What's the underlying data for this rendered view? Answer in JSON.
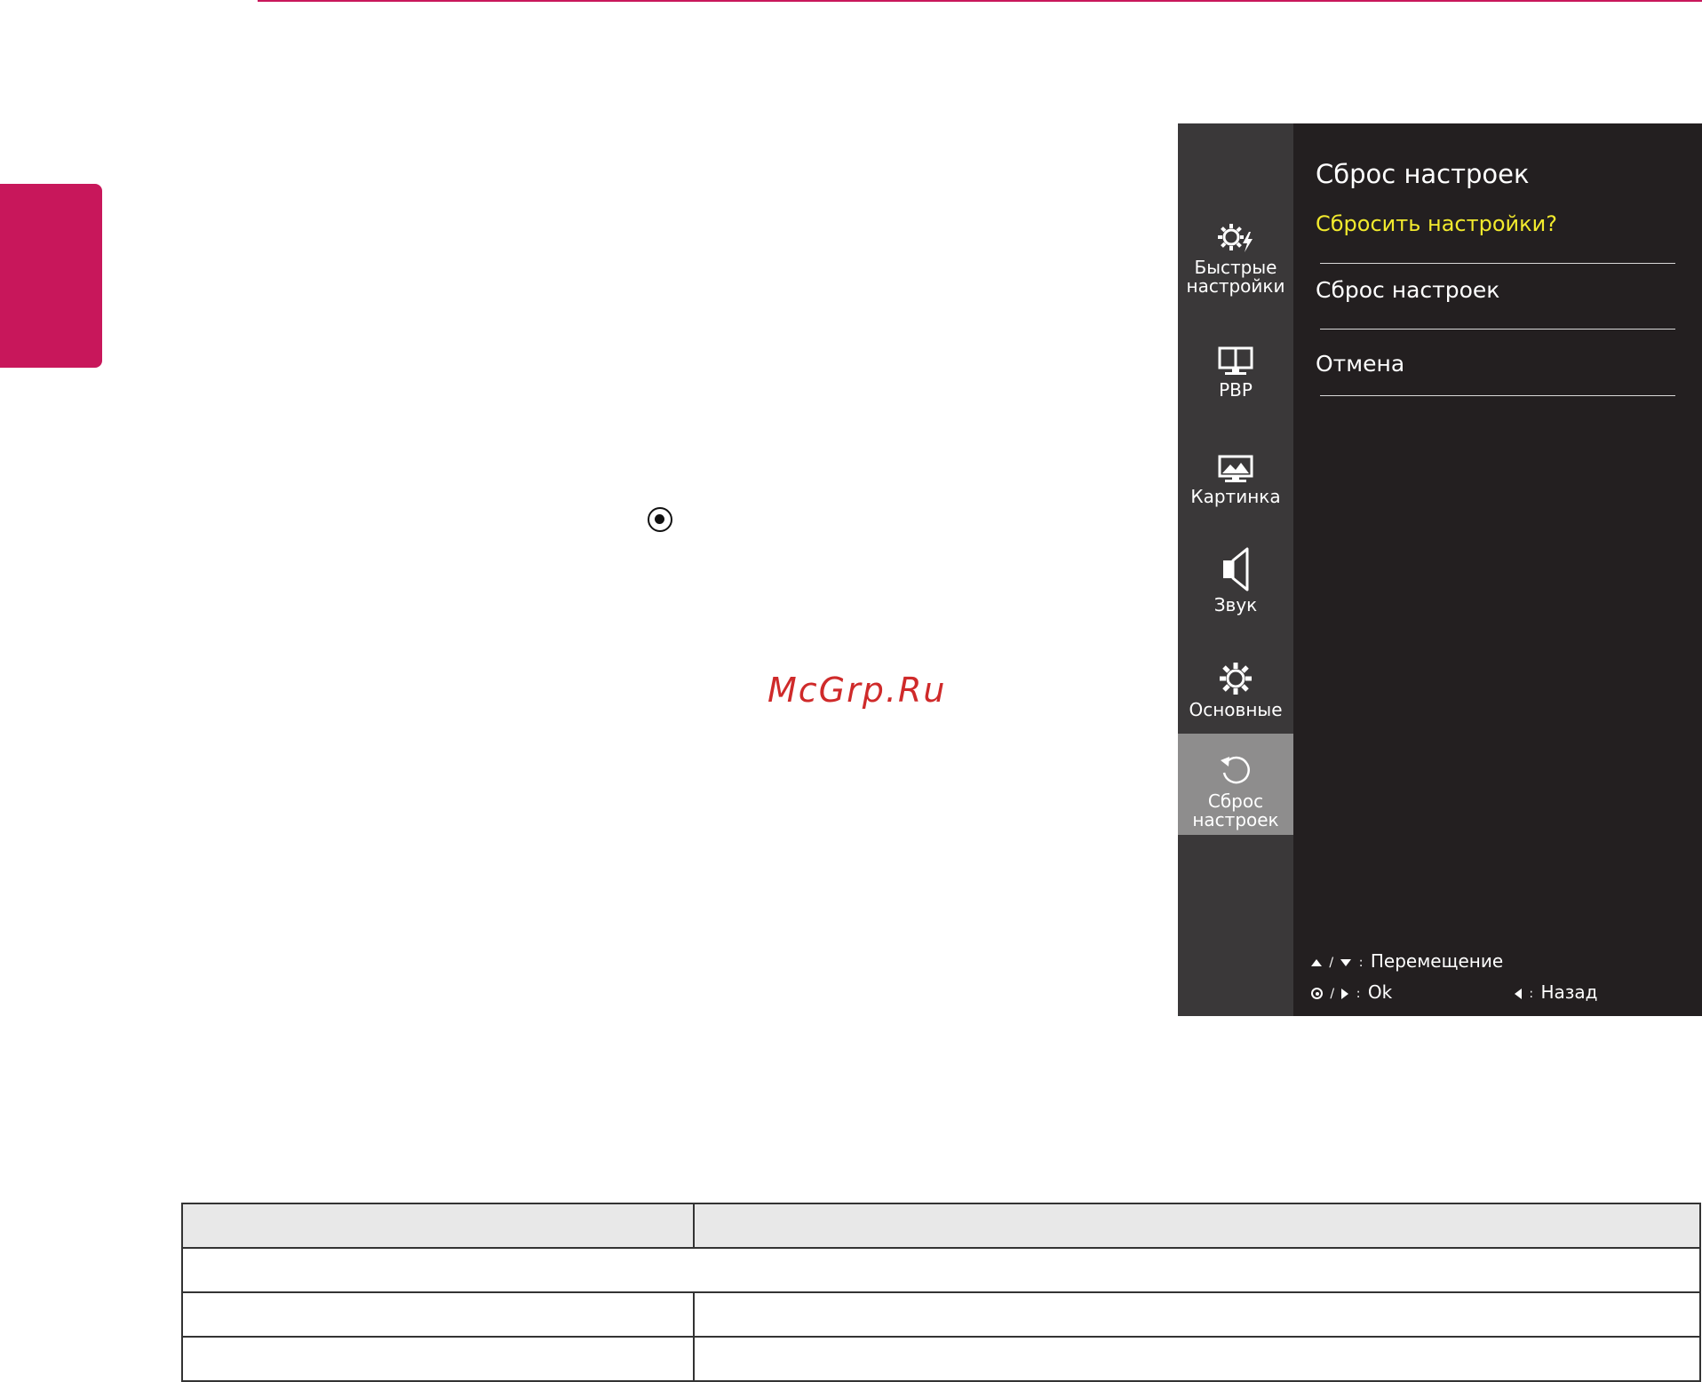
{
  "osd": {
    "nav": [
      {
        "icon": "quick-settings-icon",
        "label": "Быстрые настройки",
        "active": false
      },
      {
        "icon": "pbp-icon",
        "label": "PBP",
        "active": false
      },
      {
        "icon": "picture-icon",
        "label": "Картинка",
        "active": false
      },
      {
        "icon": "speaker-icon",
        "label": "Звук",
        "active": false
      },
      {
        "icon": "gear-icon",
        "label": "Основные",
        "active": false
      },
      {
        "icon": "reset-icon",
        "label": "Сброс настроек",
        "active": true
      }
    ],
    "title": "Сброс настроек",
    "question": "Сбросить настройки?",
    "options": [
      "Сброс настроек",
      "Отмена"
    ],
    "hints": {
      "move": "Перемещение",
      "ok": "Ok",
      "back": "Назад",
      "separator": "/",
      "colon": ":"
    },
    "colors": {
      "nav_bg": "#3a3839",
      "main_bg": "#231f20",
      "active_bg": "#8e8d8d",
      "question": "#f2ea2d"
    }
  },
  "page": {
    "watermark": "McGrp.Ru",
    "accent": "#c8175b",
    "ok_symbol": "ok-button-icon"
  }
}
